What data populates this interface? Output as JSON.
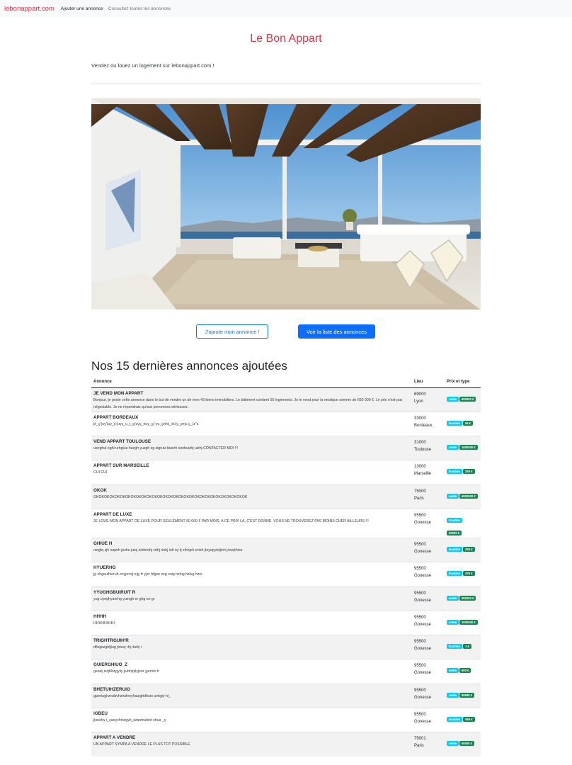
{
  "navbar": {
    "brand": "lebonappart.com",
    "links": [
      "Ajouter une annonce",
      "Consultez toutes les annonces"
    ]
  },
  "header": {
    "title": "Le Bon Appart",
    "lead": "Vendez ou louez un logement sur lebonappart.com !"
  },
  "hero_image": "modern-terrace-living-room-photo",
  "buttons": {
    "add": "J'ajoute mon annonce !",
    "list": "Voir la liste des annonces"
  },
  "section_title": "Nos 15 dernières annonces ajoutées",
  "table": {
    "headers": [
      "Annonce",
      "Lieu",
      "Prix et type"
    ],
    "rows": [
      {
        "title": "JE VEND MON APPART",
        "desc": "Bonjour, je poste cette annonce dans le but de vendre un de mes 43 biens immobiliers. Le bâtiment contient 50 logements. Je le vend pour la modique somme de 650 000 €. Le prix n'est pas négociable. Je ne répondrais qu'aux personnes sérieuses.",
        "zip": "69000",
        "city": "Lyon",
        "type": "vente",
        "price": "650000 €"
      },
      {
        "title": "APPART BORDEAUX",
        "desc": "jè_ç'(uy'(uy_ç'(uyç_u_t_ç(uyç_èuy_ç(-yu_çrthç_èu'y_çrrju ç_(z\"u",
        "zip": "33000",
        "city": "Bordeaux",
        "type": "location",
        "price": "55 €"
      },
      {
        "title": "VEND APPART TOULOUSE",
        "desc": "uierghui eghi urhgiuz huegh yuzgh zg zigruiz biurzh iurzhuizhj uizhj CONTACTER MOI !!!",
        "zip": "31000",
        "city": "Toulouse",
        "type": "vente",
        "price": "1500000 €"
      },
      {
        "title": "APPART SUR MARSEILLE",
        "desc": "CUI CUI",
        "zip": "13000",
        "city": "Marseille",
        "type": "location",
        "price": "250 €"
      },
      {
        "title": "OKOK",
        "desc": "OKOKOKOKOKOKOKOKOKOKOKOKOKOKOKOKOKOKOKOKOKOKOKOKOKOKOKOKOK",
        "zip": "75000",
        "city": "Paris",
        "type": "vente",
        "price": "6000000 €"
      },
      {
        "title": "APPART DE LUXE",
        "desc": "JE LOUE MON APPART DE LUXE POUR SEULEMENT 50 000 € PAR MOIS. A CE PRIX LA, C'EST DONNE. VOUS NE TROUVEREZ PAS MOINS CHER AILLEURS !!!",
        "zip": "95500",
        "city": "Gonesse",
        "type": "location",
        "price": "50000 €"
      },
      {
        "title": "GHIUE H",
        "desc": "uiogfq zjh iuqzrh jezhu juioj ziohriohj rzihj riohj ioh ny tj zihnjeh erioh jteyopyietjioh jnoejthioe",
        "zip": "95500",
        "city": "Gonesse",
        "type": "location",
        "price": "250 €"
      },
      {
        "title": "HYUERHG",
        "desc": "jg ehgeuihieruh eoyjeroij eijy tr yjer bfgze zeg zuig hzlug hzlug hzio",
        "zip": "95500",
        "city": "Gonesse",
        "type": "location",
        "price": "275 €"
      },
      {
        "title": "YYUGHGBUIRUIT R",
        "desc": "yug uyeghyuerhg yuergh er ghg ee gr",
        "zip": "95500",
        "city": "Gonesse",
        "type": "vente",
        "price": "500000 €"
      },
      {
        "title": "HHHH",
        "desc": "HHHHHHHH",
        "zip": "95500",
        "city": "Gonesse",
        "type": "vente",
        "price": "1000000 €"
      },
      {
        "title": "TRIGHTRGUIH'R",
        "desc": "dflogiuightjiug jtriuoj rhj rtuihj i",
        "zip": "95500",
        "city": "Gonesse",
        "type": "location",
        "price": "1 €"
      },
      {
        "title": "GUIERGHIUO_Z",
        "desc": "geazij ierjblotyjyiiy jiubhjnjlyjenr yjernio.tr",
        "zip": "95500",
        "city": "Gonesse",
        "type": "vente",
        "price": "600 €"
      },
      {
        "title": "BHETUIHZERUIO",
        "desc": "gjzeriughzruibvhzriufvnyhauighdhuio uehgiy hi_",
        "zip": "95500",
        "city": "Gonesse",
        "type": "vente",
        "price": "99999 €"
      },
      {
        "title": "IGBEU",
        "desc": "jkeurby i_çaeychnvigyb_iizaotnubiot shua _ç",
        "zip": "95500",
        "city": "Gonesse",
        "type": "location",
        "price": "555 €"
      },
      {
        "title": "APPART A VENDRE",
        "desc": "UN APPART SYMPA A VENDRE LE PLUS TOT POSSIBLE",
        "zip": "75001",
        "city": "Paris",
        "type": "vente",
        "price": "50000 €"
      }
    ]
  }
}
